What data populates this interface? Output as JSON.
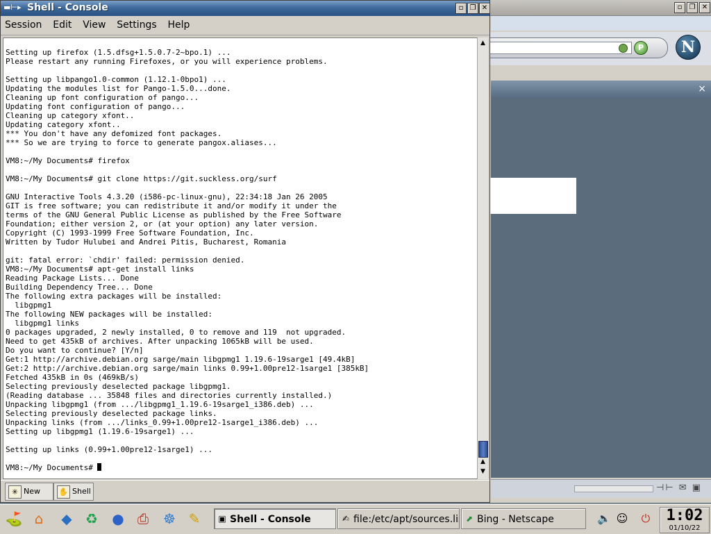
{
  "console": {
    "title": "Shell - Console",
    "menu": [
      "Session",
      "Edit",
      "View",
      "Settings",
      "Help"
    ],
    "terminal_lines": [
      "Setting up firefox (1.5.dfsg+1.5.0.7-2~bpo.1) ...",
      "Please restart any running Firefoxes, or you will experience problems.",
      "",
      "Setting up libpango1.0-common (1.12.1-0bpo1) ...",
      "Updating the modules list for Pango-1.5.0...done.",
      "Cleaning up font configuration of pango...",
      "Updating font configuration of pango...",
      "Cleaning up category xfont..",
      "Updating category xfont..",
      "*** You don't have any defomized font packages.",
      "*** So we are trying to force to generate pangox.aliases...",
      "",
      "VM8:~/My Documents# firefox",
      "",
      "VM8:~/My Documents# git clone https://git.suckless.org/surf",
      "",
      "GNU Interactive Tools 4.3.20 (i586-pc-linux-gnu), 22:34:18 Jan 26 2005",
      "GIT is free software; you can redistribute it and/or modify it under the",
      "terms of the GNU General Public License as published by the Free Software",
      "Foundation; either version 2, or (at your option) any later version.",
      "Copyright (C) 1993-1999 Free Software Foundation, Inc.",
      "Written by Tudor Hulubei and Andrei Pitis, Bucharest, Romania",
      "",
      "git: fatal error: `chdir' failed: permission denied.",
      "VM8:~/My Documents# apt-get install links",
      "Reading Package Lists... Done",
      "Building Dependency Tree... Done",
      "The following extra packages will be installed:",
      "  libgpmg1",
      "The following NEW packages will be installed:",
      "  libgpmg1 links",
      "0 packages upgraded, 2 newly installed, 0 to remove and 119  not upgraded.",
      "Need to get 435kB of archives. After unpacking 1065kB will be used.",
      "Do you want to continue? [Y/n]",
      "Get:1 http://archive.debian.org sarge/main libgpmg1 1.19.6-19sarge1 [49.4kB]",
      "Get:2 http://archive.debian.org sarge/main links 0.99+1.00pre12-1sarge1 [385kB]",
      "Fetched 435kB in 0s (469kB/s)",
      "Selecting previously deselected package libgpmg1.",
      "(Reading database ... 35848 files and directories currently installed.)",
      "Unpacking libgpmg1 (from .../libgpmg1_1.19.6-19sarge1_i386.deb) ...",
      "Selecting previously deselected package links.",
      "Unpacking links (from .../links_0.99+1.00pre12-1sarge1_i386.deb) ...",
      "Setting up libgpmg1 (1.19.6-19sarge1) ...",
      "",
      "Setting up links (0.99+1.00pre12-1sarge1) ...",
      ""
    ],
    "prompt": "VM8:~/My Documents# ",
    "tabs": [
      {
        "label": "New",
        "icon": "new-session-icon"
      },
      {
        "label": "Shell",
        "icon": "shell-icon"
      }
    ],
    "scroll_position": 0.95
  },
  "background_window": {
    "logo_letter": "N",
    "sidebar_close": "×"
  },
  "taskbar": {
    "launchers": [
      "kde-menu-icon",
      "home-icon",
      "package-icon",
      "network-icon",
      "browser-icon",
      "printer-icon",
      "accessibility-icon",
      "editor-icon"
    ],
    "tasks": [
      {
        "label": "Shell - Console",
        "active": true,
        "icon": "terminal-icon"
      },
      {
        "label": "file:/etc/apt/sources.list",
        "active": false,
        "icon": "file-icon"
      },
      {
        "label": "Bing - Netscape",
        "active": false,
        "icon": "netscape-icon"
      }
    ],
    "tray": [
      "volume-icon",
      "user-icon",
      "power-icon"
    ],
    "clock": {
      "time": "1:02",
      "date": "01/10/22"
    }
  },
  "colors": {
    "titlebar": "#2a5183",
    "desktop": "#5d7486",
    "scroll_thumb": "#2c4a8e"
  }
}
